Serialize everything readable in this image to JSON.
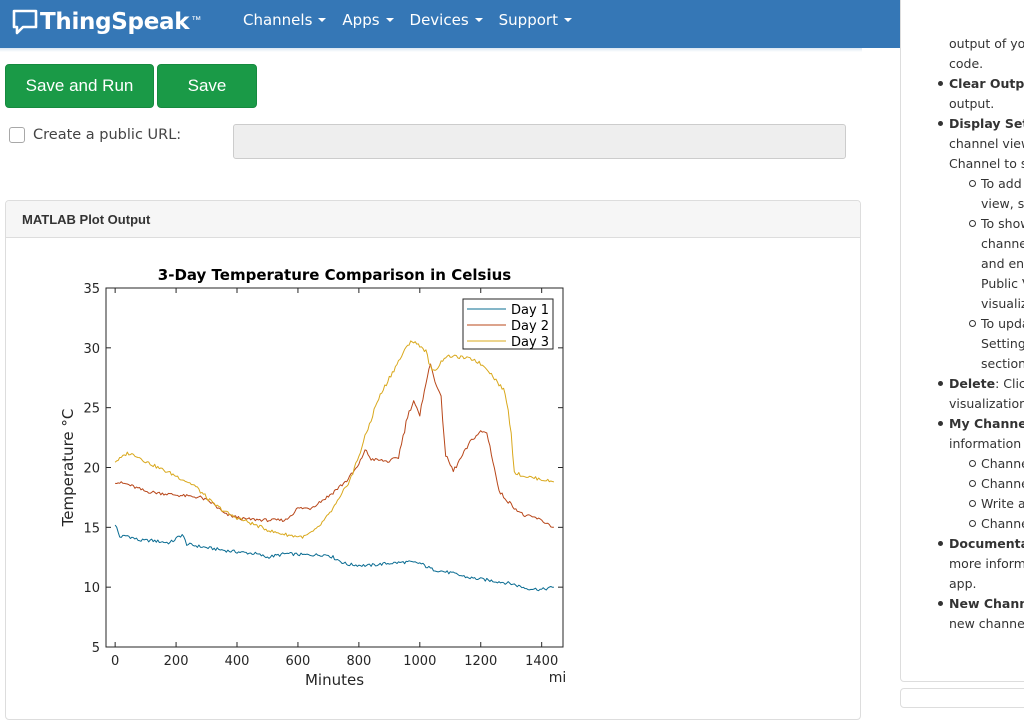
{
  "navbar": {
    "brand": "ThingSpeak",
    "tm": "™",
    "items": [
      "Channels",
      "Apps",
      "Devices",
      "Support"
    ]
  },
  "actions": {
    "save_run_label": "Save and Run",
    "save_label": "Save"
  },
  "public_url": {
    "label": "Create a public URL:",
    "checked": false,
    "value": ""
  },
  "panel": {
    "title": "MATLAB Plot Output"
  },
  "chart_data": {
    "type": "line",
    "title": "3-Day Temperature Comparison in Celsius",
    "xlabel": "Minutes",
    "x_unit": "min",
    "ylabel": "Temperature °C",
    "xlim": [
      -30,
      1470
    ],
    "ylim": [
      5,
      35
    ],
    "xticks": [
      0,
      200,
      400,
      600,
      800,
      1000,
      1200,
      1400
    ],
    "yticks": [
      5,
      10,
      15,
      20,
      25,
      30,
      35
    ],
    "grid": false,
    "legend_position": "top-right",
    "series": [
      {
        "name": "Day 1",
        "color": "#0a6c92",
        "points": [
          [
            0,
            15.3
          ],
          [
            15,
            14.2
          ],
          [
            40,
            14.3
          ],
          [
            80,
            13.9
          ],
          [
            120,
            13.9
          ],
          [
            180,
            13.7
          ],
          [
            220,
            14.4
          ],
          [
            235,
            13.6
          ],
          [
            300,
            13.3
          ],
          [
            380,
            13.0
          ],
          [
            460,
            12.8
          ],
          [
            500,
            12.5
          ],
          [
            560,
            12.8
          ],
          [
            620,
            12.7
          ],
          [
            700,
            12.7
          ],
          [
            760,
            11.9
          ],
          [
            830,
            11.8
          ],
          [
            900,
            12.0
          ],
          [
            960,
            12.1
          ],
          [
            1000,
            12.0
          ],
          [
            1040,
            11.5
          ],
          [
            1100,
            11.2
          ],
          [
            1160,
            10.8
          ],
          [
            1220,
            10.6
          ],
          [
            1300,
            10.3
          ],
          [
            1350,
            9.9
          ],
          [
            1400,
            9.8
          ],
          [
            1440,
            10.0
          ]
        ]
      },
      {
        "name": "Day 2",
        "color": "#b8471a",
        "points": [
          [
            0,
            18.8
          ],
          [
            40,
            18.6
          ],
          [
            60,
            18.4
          ],
          [
            100,
            18.0
          ],
          [
            200,
            17.7
          ],
          [
            280,
            17.5
          ],
          [
            320,
            17.0
          ],
          [
            360,
            16.1
          ],
          [
            420,
            15.7
          ],
          [
            500,
            15.6
          ],
          [
            560,
            15.6
          ],
          [
            600,
            16.6
          ],
          [
            640,
            16.6
          ],
          [
            700,
            17.6
          ],
          [
            760,
            18.9
          ],
          [
            800,
            20.2
          ],
          [
            820,
            21.5
          ],
          [
            840,
            20.7
          ],
          [
            900,
            20.5
          ],
          [
            930,
            20.9
          ],
          [
            960,
            24.3
          ],
          [
            980,
            25.6
          ],
          [
            1000,
            24.2
          ],
          [
            1015,
            26.6
          ],
          [
            1035,
            28.6
          ],
          [
            1050,
            27.3
          ],
          [
            1070,
            25.7
          ],
          [
            1085,
            21.0
          ],
          [
            1110,
            19.7
          ],
          [
            1140,
            21.0
          ],
          [
            1170,
            22.3
          ],
          [
            1200,
            23.0
          ],
          [
            1220,
            22.9
          ],
          [
            1240,
            20.6
          ],
          [
            1260,
            18.0
          ],
          [
            1300,
            16.9
          ],
          [
            1340,
            16.0
          ],
          [
            1380,
            15.8
          ],
          [
            1420,
            15.3
          ],
          [
            1440,
            15.0
          ]
        ]
      },
      {
        "name": "Day 3",
        "color": "#d9a81c",
        "points": [
          [
            0,
            20.5
          ],
          [
            20,
            20.8
          ],
          [
            40,
            21.2
          ],
          [
            70,
            21.0
          ],
          [
            100,
            20.5
          ],
          [
            140,
            20.0
          ],
          [
            200,
            19.3
          ],
          [
            260,
            18.5
          ],
          [
            320,
            17.0
          ],
          [
            380,
            16.0
          ],
          [
            460,
            15.2
          ],
          [
            520,
            14.6
          ],
          [
            580,
            14.3
          ],
          [
            620,
            14.2
          ],
          [
            660,
            14.8
          ],
          [
            700,
            16.0
          ],
          [
            740,
            17.5
          ],
          [
            780,
            19.5
          ],
          [
            820,
            22.5
          ],
          [
            860,
            25.5
          ],
          [
            900,
            27.5
          ],
          [
            940,
            29.3
          ],
          [
            970,
            30.6
          ],
          [
            1000,
            30.2
          ],
          [
            1020,
            29.7
          ],
          [
            1040,
            28.0
          ],
          [
            1060,
            28.4
          ],
          [
            1080,
            29.2
          ],
          [
            1100,
            29.3
          ],
          [
            1140,
            29.2
          ],
          [
            1180,
            29.0
          ],
          [
            1220,
            28.3
          ],
          [
            1250,
            27.3
          ],
          [
            1280,
            26.3
          ],
          [
            1300,
            23.0
          ],
          [
            1310,
            19.6
          ],
          [
            1340,
            19.3
          ],
          [
            1380,
            19.1
          ],
          [
            1420,
            18.9
          ],
          [
            1440,
            18.8
          ]
        ]
      }
    ]
  },
  "help": [
    {
      "type": "text",
      "indent": 0,
      "text": "output of you"
    },
    {
      "type": "text",
      "indent": 0,
      "text": "code."
    },
    {
      "type": "bullet",
      "bold": "Clear Output",
      "text": ""
    },
    {
      "type": "text",
      "indent": 0,
      "text": "output."
    },
    {
      "type": "bullet",
      "bold": "Display Settin",
      "text": ""
    },
    {
      "type": "text",
      "indent": 0,
      "text": "channel view"
    },
    {
      "type": "text",
      "indent": 0,
      "text": "Channel to se"
    },
    {
      "type": "sub",
      "text": "To add t"
    },
    {
      "type": "text",
      "indent": 2,
      "text": "view, se"
    },
    {
      "type": "sub",
      "text": "To show"
    },
    {
      "type": "text",
      "indent": 2,
      "text": "channe"
    },
    {
      "type": "text",
      "indent": 2,
      "text": "and ena"
    },
    {
      "type": "text",
      "indent": 2,
      "text": "Public V"
    },
    {
      "type": "text",
      "indent": 2,
      "text": "visualiz"
    },
    {
      "type": "sub",
      "text": "To upda"
    },
    {
      "type": "text",
      "indent": 2,
      "text": "Settings"
    },
    {
      "type": "text",
      "indent": 2,
      "text": "section"
    },
    {
      "type": "bullet",
      "bold": "Delete",
      "text": ": Click"
    },
    {
      "type": "text",
      "indent": 0,
      "text": "visualization"
    },
    {
      "type": "bullet",
      "bold": "My Channels",
      "text": ""
    },
    {
      "type": "text",
      "indent": 0,
      "text": "information a"
    },
    {
      "type": "sub",
      "text": "Channe"
    },
    {
      "type": "sub",
      "text": "Channe"
    },
    {
      "type": "sub",
      "text": "Write ar"
    },
    {
      "type": "sub",
      "text": "Channe"
    },
    {
      "type": "bullet",
      "bold": "Documentati",
      "text": ""
    },
    {
      "type": "text",
      "indent": 0,
      "text": "more informa"
    },
    {
      "type": "text",
      "indent": 0,
      "text": "app."
    },
    {
      "type": "bullet",
      "bold": "New Channel",
      "text": ""
    },
    {
      "type": "text",
      "indent": 0,
      "text": "new channel"
    }
  ]
}
